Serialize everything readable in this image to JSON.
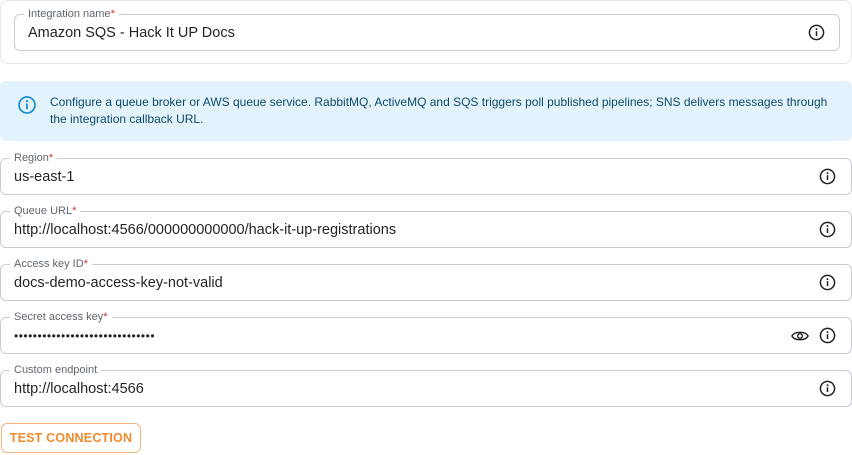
{
  "integration": {
    "label": "Integration name",
    "required_mark": "*",
    "value": "Amazon SQS - Hack It UP Docs"
  },
  "banner": {
    "text": "Configure a queue broker or AWS queue service. RabbitMQ, ActiveMQ and SQS triggers poll published pipelines; SNS delivers messages through the integration callback URL."
  },
  "fields": {
    "region": {
      "label": "Region",
      "required_mark": "*",
      "value": "us-east-1"
    },
    "queue_url": {
      "label": "Queue URL",
      "required_mark": "*",
      "value": "http://localhost:4566/000000000000/hack-it-up-registrations"
    },
    "access_key_id": {
      "label": "Access key ID",
      "required_mark": "*",
      "value": "docs-demo-access-key-not-valid"
    },
    "secret_access_key": {
      "label": "Secret access key",
      "required_mark": "*",
      "value": "••••••••••••••••••••••••••••••"
    },
    "custom_endpoint": {
      "label": "Custom endpoint",
      "value": "http://localhost:4566"
    }
  },
  "actions": {
    "test_connection": "TEST CONNECTION"
  },
  "icons": {
    "info": "info-icon",
    "eye": "eye-icon"
  },
  "colors": {
    "banner_bg": "#e3f3fc",
    "banner_icon": "#1a8fd1",
    "required": "#d32f2f",
    "accent": "#f08a2c"
  }
}
